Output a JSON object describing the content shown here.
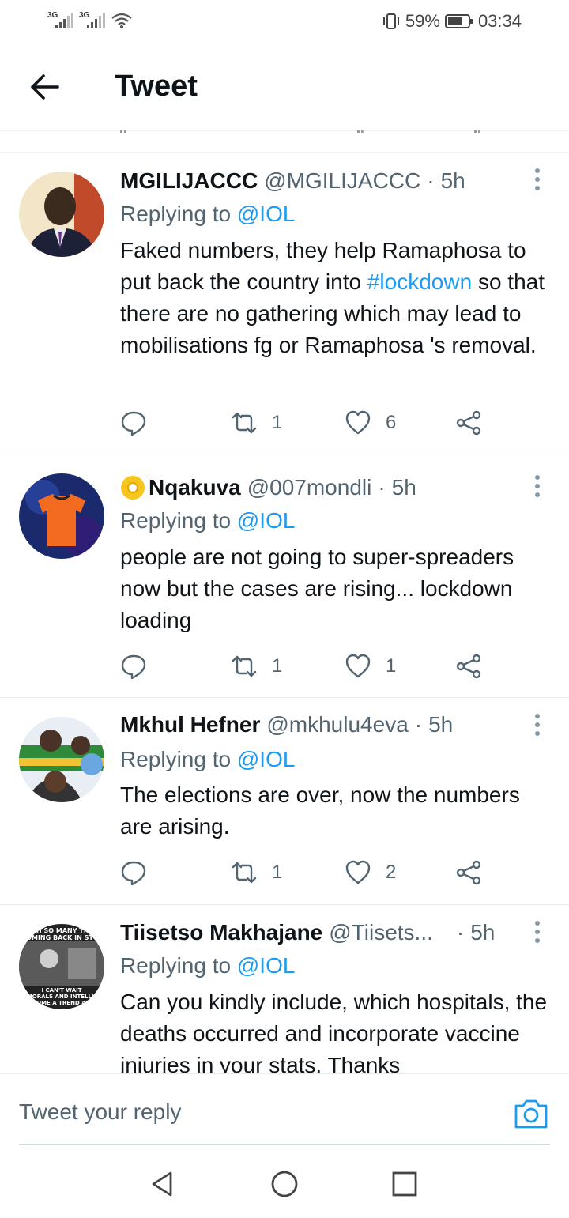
{
  "status_bar": {
    "sim1": "3G",
    "sim2": "3G",
    "battery": "59%",
    "time": "03:34"
  },
  "header": {
    "title": "Tweet"
  },
  "tweets": [
    {
      "name": "MGILIJACCC",
      "handle": "@MGILIJACCC",
      "time": "5h",
      "replying_prefix": "Replying to ",
      "replying_to": "@IOL",
      "text_parts": [
        "Faked numbers, they help Ramaphosa to put back the country into ",
        "#lockdown",
        " so that there are no gathering which may lead to mobilisations fg or Ramaphosa 's removal."
      ],
      "retweets": "1",
      "likes": "6"
    },
    {
      "name": "Nqakuva",
      "handle": "@007mondli",
      "time": "5h",
      "replying_prefix": "Replying to ",
      "replying_to": "@IOL",
      "text": "people are not going to super-spreaders now but the cases are rising... lockdown loading",
      "retweets": "1",
      "likes": "1"
    },
    {
      "name": "Mkhul Hefner",
      "handle": "@mkhulu4eva",
      "time": "5h",
      "replying_prefix": "Replying to ",
      "replying_to": "@IOL",
      "text": "The elections are over, now the numbers are arising.",
      "retweets": "1",
      "likes": "2"
    },
    {
      "name": "Tiisetso Makhajane",
      "handle": "@Tiisets...",
      "time": "5h",
      "replying_prefix": "Replying to ",
      "replying_to": "@IOL",
      "text": "Can you kindly include, which hospitals, the deaths occurred and  incorporate vaccine injuries in your stats. Thanks",
      "avatar_text": [
        "TH SO MANY THI",
        "COMING BACK IN STYL",
        "I CAN'T WAIT",
        "L MORALS AND INTELLIGE",
        "ECOME A TREND AGA"
      ]
    }
  ],
  "reply_bar": {
    "placeholder": "Tweet your reply"
  },
  "colors": {
    "accent": "#1d9bf0",
    "secondary_text": "#536471",
    "primary_text": "#0f1419"
  },
  "icons": {
    "back": "arrow-left-icon",
    "more": "more-vertical-icon",
    "reply": "reply-bubble-icon",
    "retweet": "retweet-icon",
    "like": "heart-icon",
    "share": "share-icon",
    "camera": "camera-icon"
  }
}
